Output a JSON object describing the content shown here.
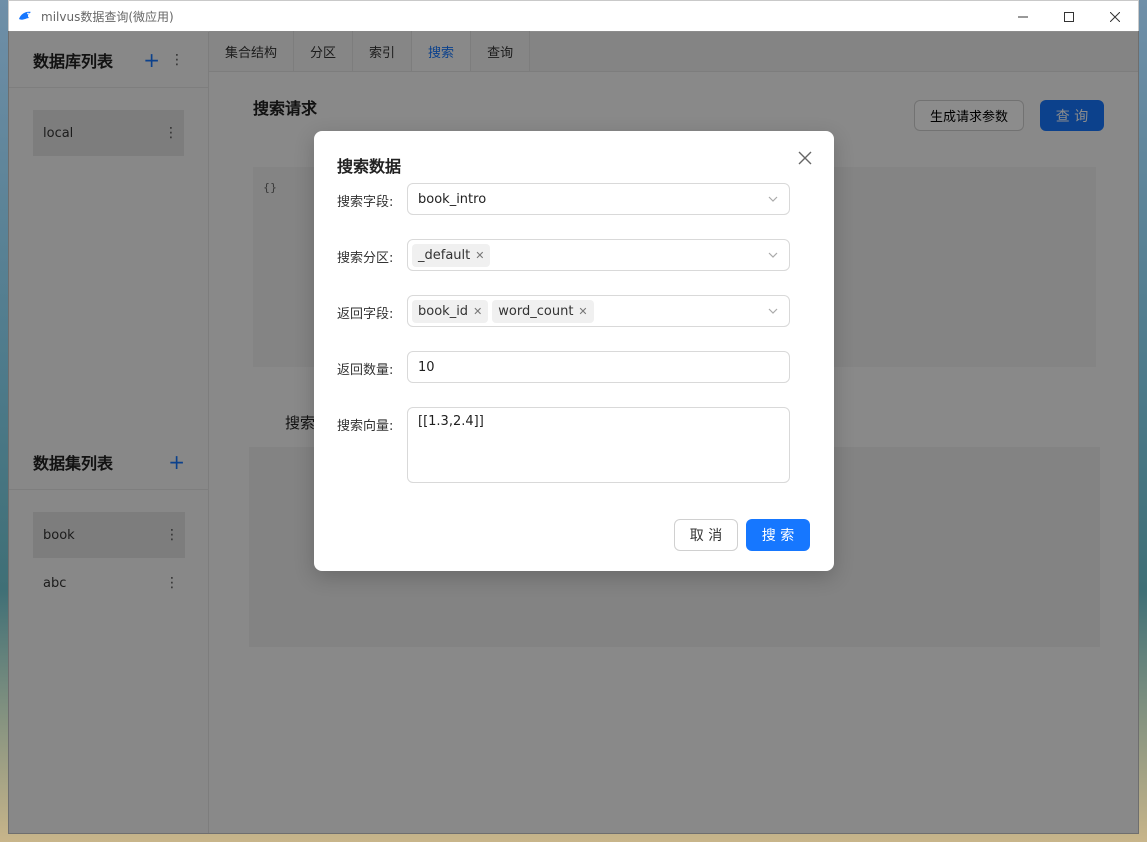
{
  "window": {
    "title": "milvus数据查询(微应用)",
    "icon": "milvus-bird-icon"
  },
  "sidebar": {
    "db_section_title": "数据库列表",
    "databases": [
      {
        "label": "local",
        "active": true
      }
    ],
    "collection_section_title": "数据集列表",
    "collections": [
      {
        "label": "book",
        "active": true
      },
      {
        "label": "abc",
        "active": false
      }
    ]
  },
  "tabs": [
    {
      "label": "集合结构"
    },
    {
      "label": "分区"
    },
    {
      "label": "索引"
    },
    {
      "label": "搜索",
      "active": true
    },
    {
      "label": "查询"
    }
  ],
  "request": {
    "title": "搜索请求",
    "generate_label": "生成请求参数",
    "query_label": "查 询",
    "code": "{}"
  },
  "result": {
    "title": "搜索"
  },
  "modal": {
    "title": "搜索数据",
    "fields": {
      "search_field": {
        "label": "搜索字段:",
        "value": "book_intro"
      },
      "partition": {
        "label": "搜索分区:",
        "tags": [
          "_default"
        ]
      },
      "return_fields": {
        "label": "返回字段:",
        "tags": [
          "book_id",
          "word_count"
        ]
      },
      "return_count": {
        "label": "返回数量:",
        "value": "10"
      },
      "vector": {
        "label": "搜索向量:",
        "value": "[[1.3,2.4]]"
      }
    },
    "cancel_label": "取 消",
    "search_label": "搜 索"
  },
  "colors": {
    "accent": "#1677ff",
    "overlay": "rgba(0,0,0,0.45)"
  }
}
